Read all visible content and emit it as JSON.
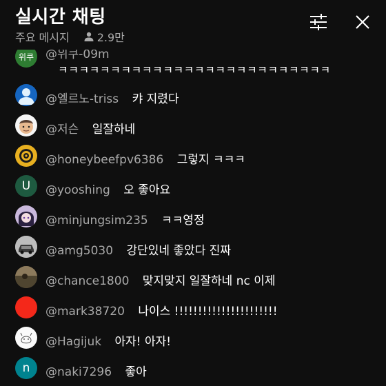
{
  "header": {
    "title": "실시간 채팅",
    "mode_label": "주요 메시지",
    "viewer_count": "2.9만"
  },
  "icons": {
    "filter": "tune-sliders-icon",
    "close": "close-icon",
    "viewers": "person-icon"
  },
  "messages": [
    {
      "avatar_text": "위쿠",
      "author": "@위쿠-09m",
      "text": "",
      "continuation": "ㅋㅋㅋㅋㅋㅋㅋㅋㅋㅋㅋㅋㅋㅋㅋㅋㅋㅋㅋㅋㅋㅋㅋㅋㅋㅋ"
    },
    {
      "avatar_text": "",
      "author": "@엘르노-triss",
      "text": "캬 지렸다"
    },
    {
      "avatar_text": "",
      "author": "@저슨",
      "text": "일잘하네"
    },
    {
      "avatar_text": "",
      "author": "@honeybeefpv6386",
      "text": "그렇지 ㅋㅋㅋ"
    },
    {
      "avatar_text": "U",
      "author": "@yooshing",
      "text": "오 좋아요"
    },
    {
      "avatar_text": "",
      "author": "@minjungsim235",
      "text": "ㅋㅋ영정"
    },
    {
      "avatar_text": "",
      "author": "@amg5030",
      "text": "강단있네 좋았다 진짜"
    },
    {
      "avatar_text": "",
      "author": "@chance1800",
      "text": "맞지맞지 일잘하네 nc 이제"
    },
    {
      "avatar_text": "",
      "author": "@mark38720",
      "text": "나이스 !!!!!!!!!!!!!!!!!!!!!!"
    },
    {
      "avatar_text": "",
      "author": "@Hagijuk",
      "text": "아자! 아자!"
    },
    {
      "avatar_text": "n",
      "author": "@naki7296",
      "text": "좋아"
    }
  ]
}
